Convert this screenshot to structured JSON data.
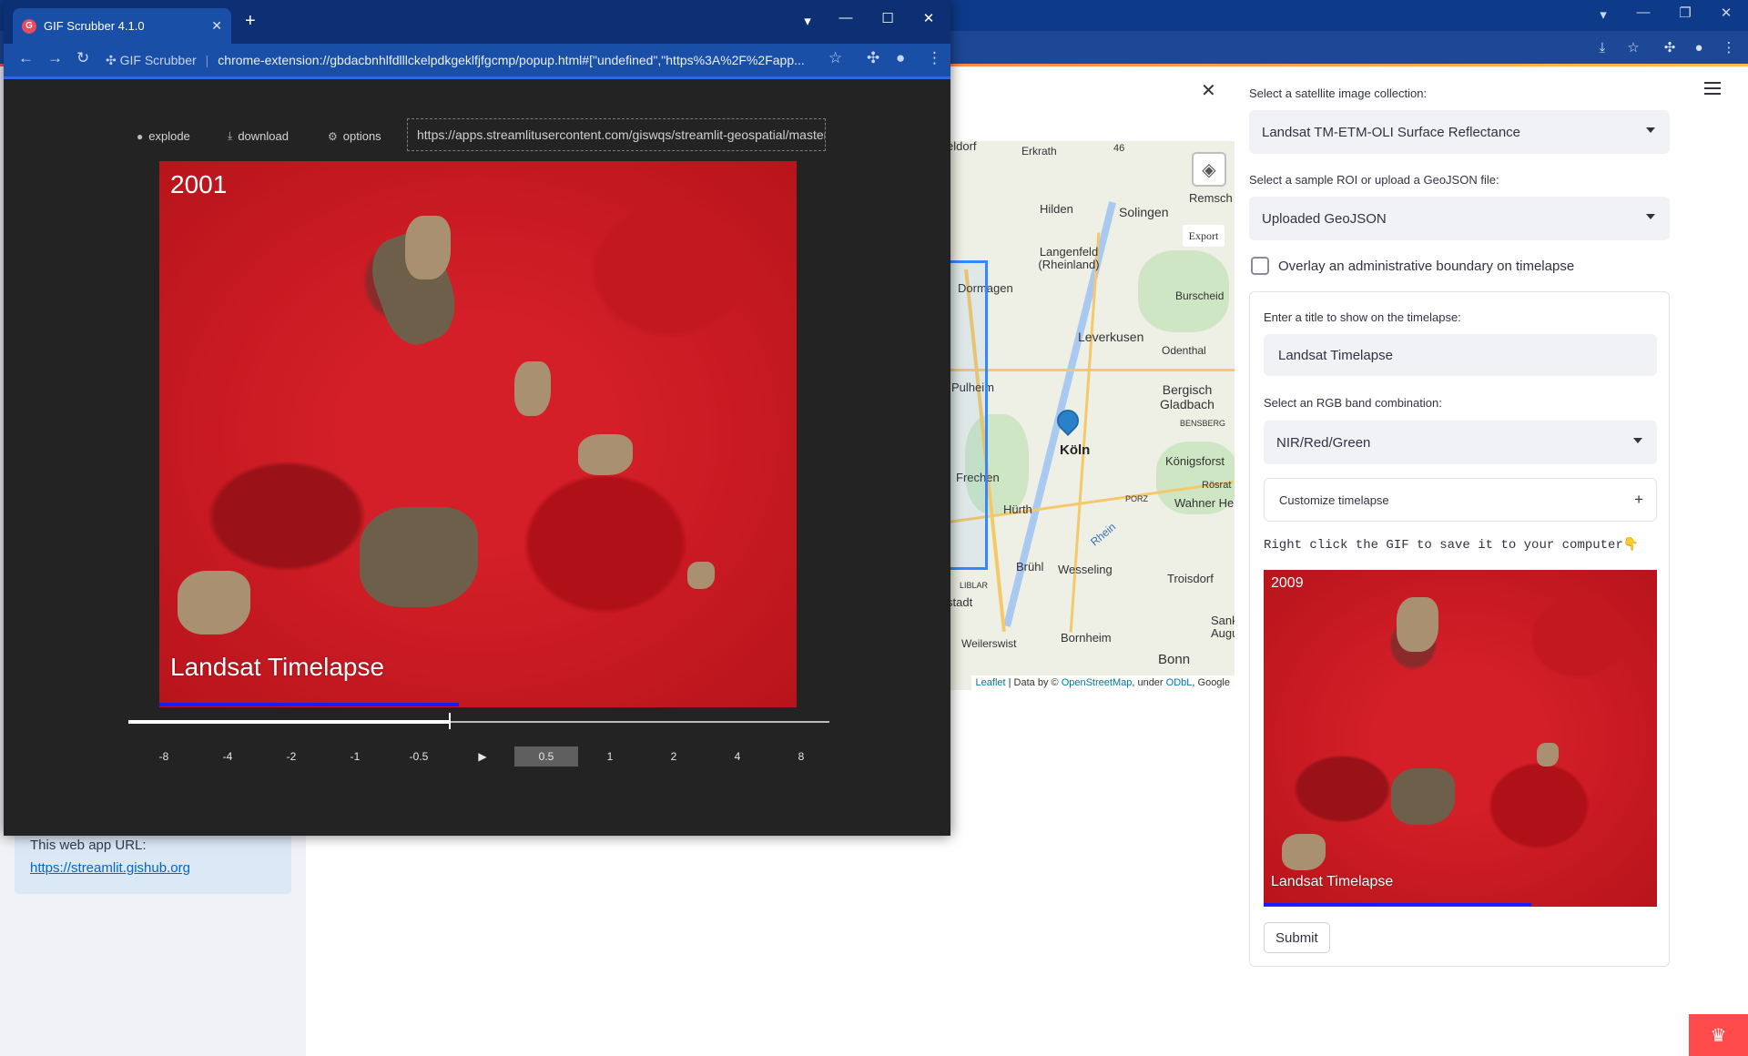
{
  "background_browser": {
    "window_controls": [
      "▾",
      "—",
      "❐",
      "—",
      "✕"
    ]
  },
  "sidebar": {
    "info_text": "This web app URL:",
    "info_link": "https://streamlit.gishub.org"
  },
  "map": {
    "places": [
      {
        "name": "eldorf"
      },
      {
        "name": "Erkrath"
      },
      {
        "name": "46"
      },
      {
        "name": "Remsch"
      },
      {
        "name": "Hilden"
      },
      {
        "name": "Solingen"
      },
      {
        "name": "Langenfeld (Rheinland)"
      },
      {
        "name": "Dormagen"
      },
      {
        "name": "Burscheid"
      },
      {
        "name": "Leverkusen"
      },
      {
        "name": "Odenthal"
      },
      {
        "name": "Pulheim"
      },
      {
        "name": "Bergisch Gladbach"
      },
      {
        "name": "BENSBERG"
      },
      {
        "name": "Köln"
      },
      {
        "name": "Königsforst"
      },
      {
        "name": "Frechen"
      },
      {
        "name": "Rösrat"
      },
      {
        "name": "PORZ"
      },
      {
        "name": "Wahner He"
      },
      {
        "name": "Hürth"
      },
      {
        "name": "Rhein"
      },
      {
        "name": "Brühl"
      },
      {
        "name": "Wesseling"
      },
      {
        "name": "Troisdorf"
      },
      {
        "name": "LIBLAR"
      },
      {
        "name": "stadt"
      },
      {
        "name": "Sank Augus"
      },
      {
        "name": "Weilerswist"
      },
      {
        "name": "Bornheim"
      },
      {
        "name": "Bonn"
      }
    ],
    "export_label": "Export",
    "attribution": {
      "leaflet": "Leaflet",
      "sep": " | Data by © ",
      "osm": "OpenStreetMap",
      "under": ", under ",
      "odbl": "ODbL",
      "google": ", Google"
    }
  },
  "controls": {
    "close": "✕",
    "collection_label": "Select a satellite image collection:",
    "collection_value": "Landsat TM-ETM-OLI Surface Reflectance",
    "roi_label": "Select a sample ROI or upload a GeoJSON file:",
    "roi_value": "Uploaded GeoJSON",
    "overlay_label": "Overlay an administrative boundary on timelapse",
    "title_label": "Enter a title to show on the timelapse:",
    "title_value": "Landsat Timelapse",
    "band_label": "Select an RGB band combination:",
    "band_value": "NIR/Red/Green",
    "customize_label": "Customize timelapse",
    "save_hint": "Right click the GIF to save it to your computer👇",
    "preview_year": "2009",
    "preview_title": "Landsat Timelapse",
    "preview_progress": 0.68,
    "submit_label": "Submit"
  },
  "popup": {
    "tab_title": "GIF Scrubber 4.1.0",
    "site_name": "GIF Scrubber",
    "url": "chrome-extension://gbdacbnhlfdlllckelpdkgeklfjfgcmp/popup.html#[\"undefined\",\"https%3A%2F%2Fapp...",
    "toolbar": {
      "explode": "explode",
      "download": "download",
      "options": "options",
      "gif_url": "https://apps.streamlitusercontent.com/giswqs/streamlit-geospatial/master/a"
    },
    "gif_year": "2001",
    "gif_title": "Landsat Timelapse",
    "gif_progress": 0.47,
    "scrub_position": 0.457,
    "speeds": [
      "-8",
      "-4",
      "-2",
      "-1",
      "-0.5",
      "▶",
      "0.5",
      "1",
      "2",
      "4",
      "8"
    ],
    "active_speed": "0.5"
  }
}
